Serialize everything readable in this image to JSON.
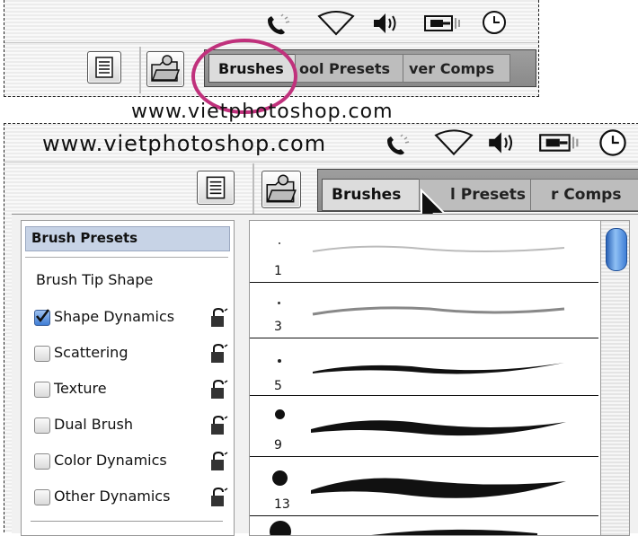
{
  "watermark": "www.vietphotoshop.com",
  "top_panel": {
    "tabs": [
      {
        "label": "Brushes"
      },
      {
        "label": "ool Presets"
      },
      {
        "label": "ver Comps"
      }
    ]
  },
  "bottom_panel": {
    "watermark": "www.vietphotoshop.com",
    "tabs": [
      {
        "label": "Brushes"
      },
      {
        "label": "l Presets"
      },
      {
        "label": "r Comps"
      }
    ],
    "options": {
      "header": "Brush Presets",
      "tip_shape": "Brush Tip Shape",
      "items": [
        {
          "label": "Shape Dynamics",
          "checked": true
        },
        {
          "label": "Scattering",
          "checked": false
        },
        {
          "label": "Texture",
          "checked": false
        },
        {
          "label": "Dual Brush",
          "checked": false
        },
        {
          "label": "Color Dynamics",
          "checked": false
        },
        {
          "label": "Other Dynamics",
          "checked": false
        }
      ]
    },
    "brushes": [
      {
        "size": "1"
      },
      {
        "size": "3"
      },
      {
        "size": "5"
      },
      {
        "size": "9"
      },
      {
        "size": "13"
      }
    ]
  },
  "colors": {
    "highlight_circle": "#c0317c",
    "header_selected": "#c7d3e6",
    "scroll_thumb": "#3f7ed6"
  }
}
